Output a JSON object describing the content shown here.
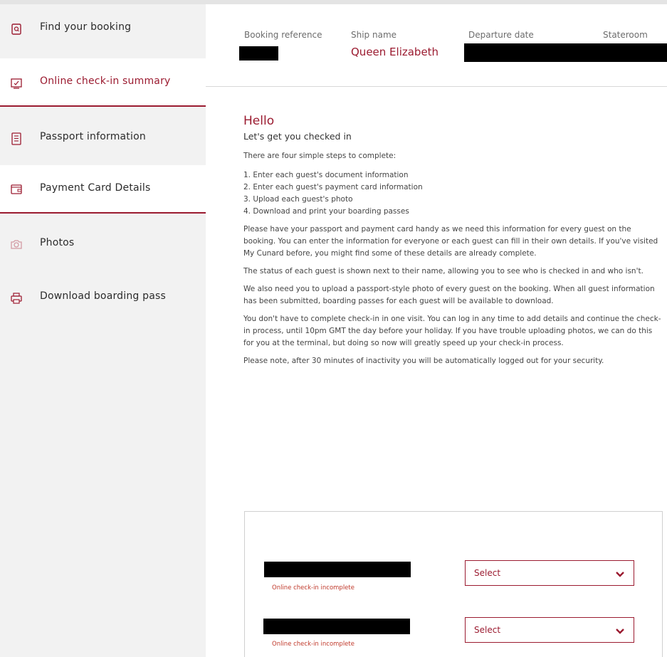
{
  "sidebar": {
    "items": [
      {
        "label": "Find your booking",
        "icon": "search-document-icon"
      },
      {
        "label": "Online check-in summary",
        "icon": "summary-icon"
      },
      {
        "label": "Passport information",
        "icon": "passport-icon"
      },
      {
        "label": "Payment Card Details",
        "icon": "wallet-icon"
      },
      {
        "label": "Photos",
        "icon": "camera-icon"
      },
      {
        "label": "Download boarding pass",
        "icon": "printer-icon"
      }
    ]
  },
  "header": {
    "booking_reference_label": "Booking reference",
    "ship_name_label": "Ship name",
    "ship_name_value": "Queen Elizabeth",
    "departure_date_label": "Departure date",
    "stateroom_label": "Stateroom"
  },
  "content": {
    "hello": "Hello",
    "subtitle": "Let's get you checked in",
    "intro": "There are four simple steps to complete:",
    "steps": [
      "1. Enter each guest's document information",
      "2. Enter each guest's payment card information",
      "3. Upload each guest's photo",
      "4. Download and print your boarding passes"
    ],
    "paragraphs": [
      "Please have your passport and payment card handy as we need this information for every guest on the booking. You can enter the information for everyone or each guest can fill in their own details. If you've visited My Cunard before, you might find some of these details are already complete.",
      "The status of each guest is shown next to their name, allowing you to see who is checked in and who isn't.",
      "We also need you to upload a passport-style photo of every guest on the booking. When all guest information has been submitted, boarding passes for each guest will be available to download.",
      "You don't have to complete check-in in one visit. You can log in any time to add details and continue the check-in process, until 10pm GMT the day before your holiday. If you have trouble uploading photos, we can do this for you at the terminal, but doing so now will greatly speed up your check-in process.",
      "Please note, after 30 minutes of inactivity you will be automatically logged out for your security."
    ]
  },
  "guests": [
    {
      "status": "Online check-in incomplete",
      "select_label": "Select"
    },
    {
      "status": "Online check-in incomplete",
      "select_label": "Select"
    }
  ],
  "colors": {
    "accent": "#9b1b30",
    "sidebar_bg": "#f2f2f2",
    "status_red": "#c0392b"
  }
}
